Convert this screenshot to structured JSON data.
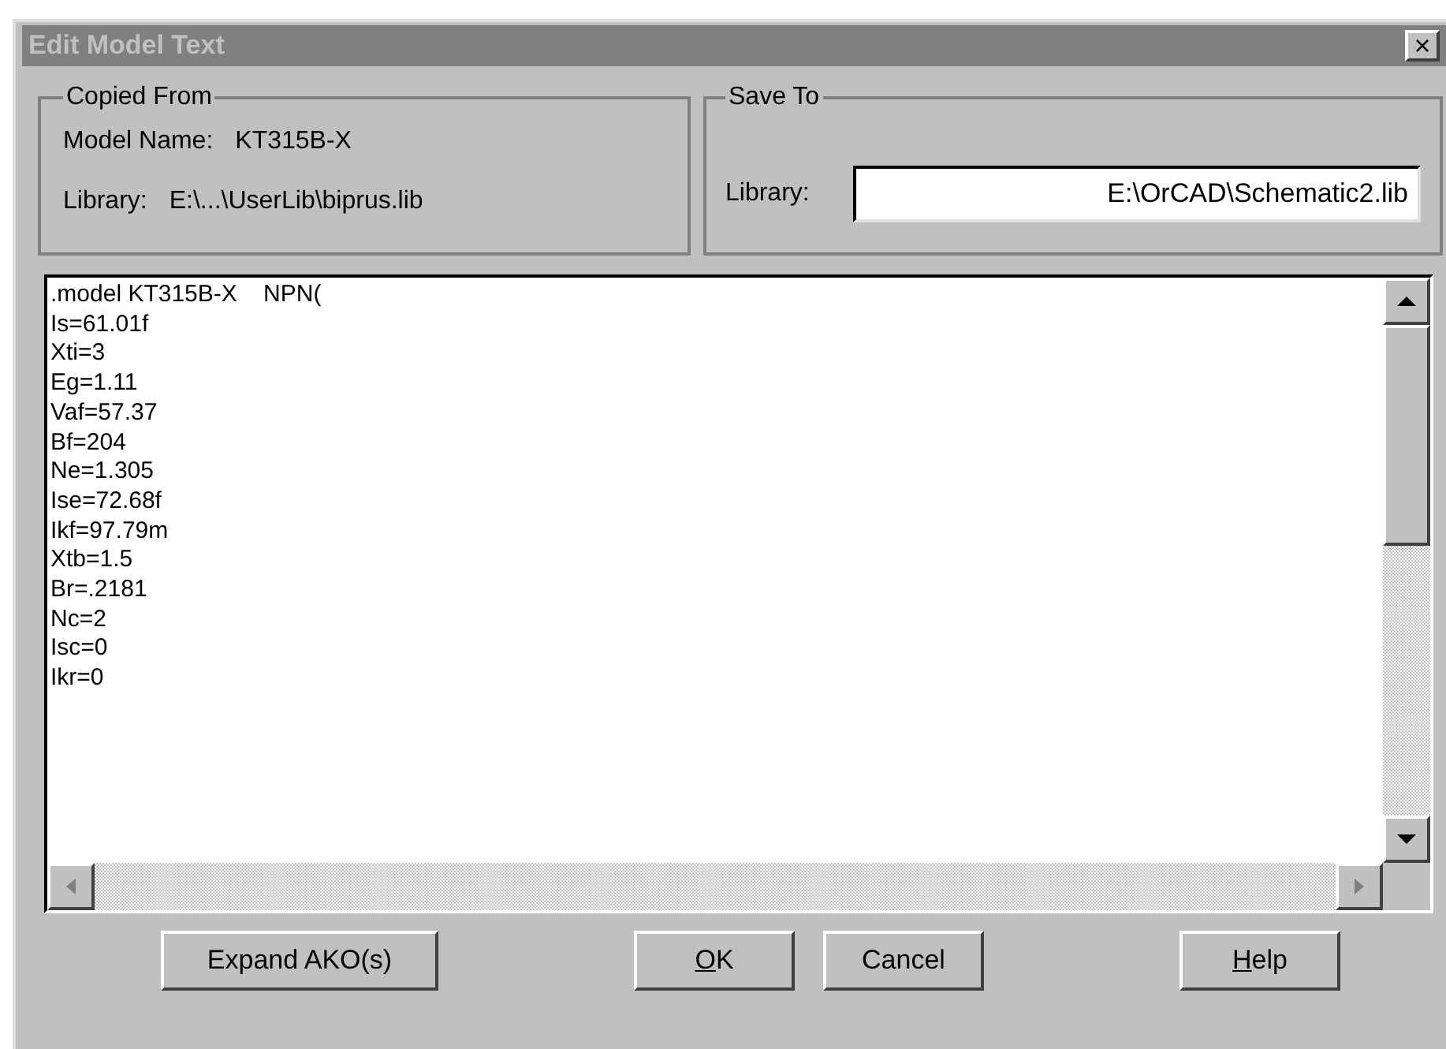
{
  "window": {
    "title": "Edit Model Text",
    "close": "×"
  },
  "copied_from": {
    "title": "Copied From",
    "fields": [
      {
        "label": "Model Name:",
        "value": "KT315B-X"
      },
      {
        "label": "Library:",
        "value": "E:\\...\\UserLib\\biprus.lib"
      }
    ]
  },
  "save_to": {
    "title": "Save To",
    "label": "Library:",
    "value": "E:\\OrCAD\\Schematic2.lib"
  },
  "editor": {
    "lines": [
      ".model KT315B-X    NPN(",
      "Is=61.01f",
      "Xti=3",
      "Eg=1.11",
      "Vaf=57.37",
      "Bf=204",
      "Ne=1.305",
      "Ise=72.68f",
      "Ikf=97.79m",
      "Xtb=1.5",
      "Br=.2181",
      "Nc=2",
      "Isc=0",
      "Ikr=0"
    ]
  },
  "buttons": [
    {
      "label": "Expand AKO(s)"
    },
    {
      "mnemonic": "O",
      "label": "K"
    },
    {
      "label": "Cancel"
    },
    {
      "mnemonic": "H",
      "label": "elp"
    }
  ]
}
